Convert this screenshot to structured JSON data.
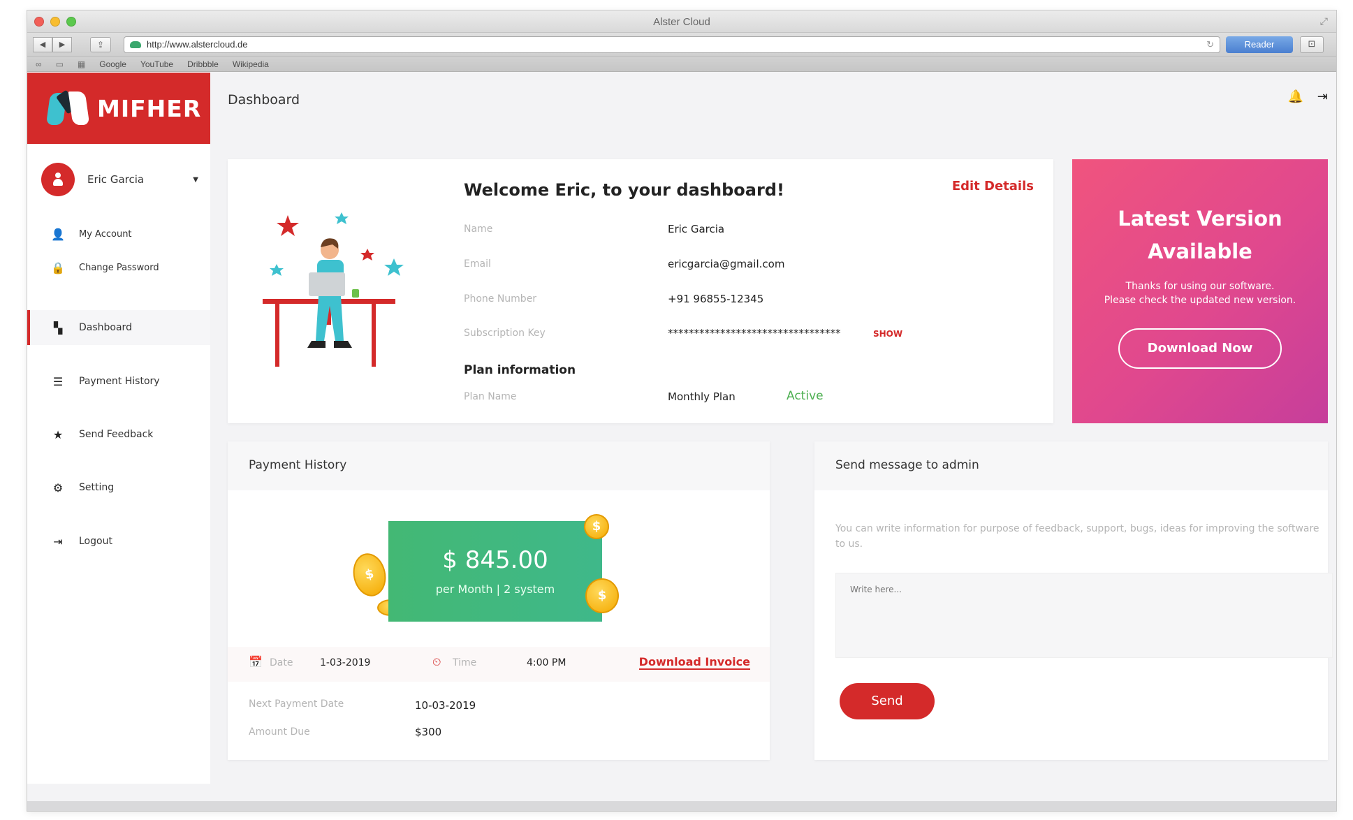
{
  "browser": {
    "window_title": "Alster Cloud",
    "url": "http://www.alstercloud.de",
    "reader_label": "Reader",
    "bookmarks": [
      "Google",
      "YouTube",
      "Dribbble",
      "Wikipedia"
    ]
  },
  "brand": {
    "name": "MIFHER",
    "color": "#d42a2a"
  },
  "sidebar": {
    "user": {
      "name": "Eric Garcia"
    },
    "sub_items": [
      {
        "label": "My Account",
        "icon": "user-icon"
      },
      {
        "label": "Change Password",
        "icon": "lock-icon"
      }
    ],
    "items": [
      {
        "label": "Dashboard",
        "icon": "dashboard-icon",
        "active": true
      },
      {
        "label": "Payment History",
        "icon": "list-icon"
      },
      {
        "label": "Send Feedback",
        "icon": "star-icon"
      },
      {
        "label": "Setting",
        "icon": "gear-icon"
      },
      {
        "label": "Logout",
        "icon": "logout-icon"
      }
    ]
  },
  "header": {
    "title": "Dashboard"
  },
  "welcome": {
    "title": "Welcome Eric, to your dashboard!",
    "edit_label": "Edit Details",
    "fields": [
      {
        "label": "Name",
        "value": "Eric Garcia"
      },
      {
        "label": "Email",
        "value": "ericgarcia@gmail.com"
      },
      {
        "label": "Phone Number",
        "value": "+91 96855-12345"
      },
      {
        "label": "Subscription Key",
        "value": "*********************************"
      }
    ],
    "show_label": "SHOW",
    "plan_heading": "Plan information",
    "plan_label": "Plan Name",
    "plan_value": "Monthly Plan",
    "plan_status": "Active"
  },
  "promo": {
    "title_line1": "Latest Version",
    "title_line2": "Available",
    "text_line1": "Thanks for using our software.",
    "text_line2": "Please check the updated new version.",
    "button_label": "Download Now"
  },
  "payment": {
    "heading": "Payment History",
    "amount": "$ 845.00",
    "amount_sub": "per Month | 2 system",
    "date_label": "Date",
    "date_value": "1-03-2019",
    "time_label": "Time",
    "time_value": "4:00 PM",
    "invoice_label": "Download Invoice",
    "next_label": "Next Payment Date",
    "next_value": "10-03-2019",
    "due_label": "Amount Due",
    "due_value": "$300"
  },
  "message": {
    "heading": "Send message to admin",
    "description": "You can write information for purpose of feedback, support, bugs, ideas for improving the software to us.",
    "placeholder": "Write here...",
    "send_label": "Send"
  }
}
